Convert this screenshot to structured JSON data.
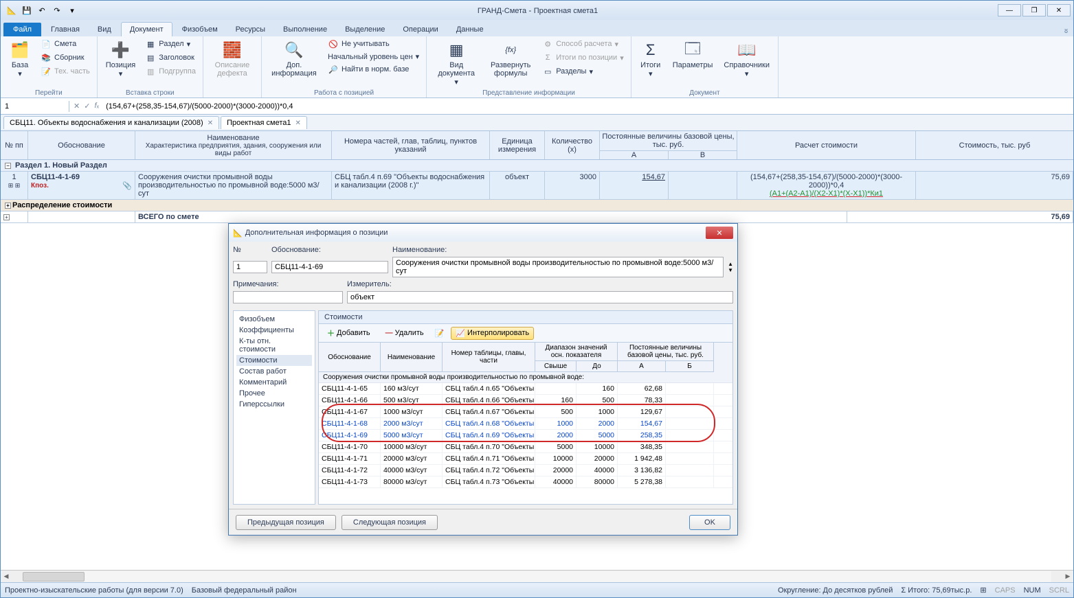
{
  "titlebar": {
    "app": "ГРАНД-Смета",
    "file": "Проектная смета1"
  },
  "tabs": {
    "file": "Файл",
    "home": "Главная",
    "view": "Вид",
    "document": "Документ",
    "fizob": "Физобъем",
    "resources": "Ресурсы",
    "exec": "Выполнение",
    "select": "Выделение",
    "ops": "Операции",
    "data": "Данные"
  },
  "ribbon": {
    "go": {
      "base": "База",
      "smeta": "Смета",
      "sbornik": "Сборник",
      "tehchast": "Тех. часть",
      "label": "Перейти"
    },
    "insert": {
      "position": "Позиция",
      "razdel": "Раздел",
      "zagolovok": "Заголовок",
      "podgruppa": "Подгруппа",
      "label": "Вставка строки"
    },
    "defect": {
      "label": "Описание дефекта"
    },
    "dopinfo": {
      "btn": "Доп. информация",
      "neuchit": "Не учитывать",
      "nachlvl": "Начальный уровень цен",
      "normbase": "Найти в норм. базе",
      "label": "Работа с позицией"
    },
    "pred": {
      "viddoc": "Вид документа",
      "razvform": "Развернуть формулы",
      "sposob": "Способ расчета",
      "itogipos": "Итоги по позиции",
      "razdely": "Разделы",
      "label": "Представление информации"
    },
    "doc": {
      "itogi": "Итоги",
      "param": "Параметры",
      "sprav": "Справочники",
      "label": "Документ"
    }
  },
  "formula": {
    "name": "1",
    "text": "(154,67+(258,35-154,67)/(5000-2000)*(3000-2000))*0,4"
  },
  "doctabs": {
    "t1": "СБЦ11. Объекты водоснабжения и канализации (2008)",
    "t2": "Проектная смета1"
  },
  "gridhead": {
    "npp": "№ пп",
    "obosn": "Обоснование",
    "naimen_top": "Наименование",
    "naimen_sub": "Характеристика предприятия, здания, сооружения или виды работ",
    "nomera": "Номера частей, глав, таблиц, пунктов указаний",
    "edin": "Единица измерения",
    "qty_top": "Количество",
    "qty_sub": "(x)",
    "const_top": "Постоянные величины базовой цены, тыс. руб.",
    "const_a": "А",
    "const_b": "В",
    "raschet": "Расчет стоимости",
    "stoim": "Стоимость, тыс. руб"
  },
  "section1": "Раздел 1. Новый Раздел",
  "row1": {
    "npp": "1",
    "obosn": "СБЦ11-4-1-69",
    "kpoz": "Кпоз.",
    "naimen": "Сооружения очистки промывной воды производительностью по промывной воде:5000 м3/сут",
    "nomera": "СБЦ табл.4 п.69 \"Объекты водоснабжения и канализации (2008 г.)\"",
    "edin": "объект",
    "qty": "3000",
    "a": "154,67",
    "raschet1": "(154,67+(258,35-154,67)/(5000-2000)*(3000-2000))*0,4",
    "raschet2": "(А1+(А2-А1)/(Х2-Х1)*(Х-Х1))*Ки1",
    "sum": "75,69"
  },
  "distrib": "Распределение стоимости",
  "total": {
    "label": "ВСЕГО по смете",
    "sum": "75,69"
  },
  "status": {
    "left1": "Проектно-изыскательские работы (для версии 7.0)",
    "left2": "Базовый федеральный район",
    "okr": "Округление: До десятков рублей",
    "itogo": "Итого: 75,69тыс.р.",
    "caps": "CAPS",
    "num": "NUM",
    "scrl": "SCRL"
  },
  "modal": {
    "title": "Дополнительная информация о позиции",
    "labels": {
      "num": "№",
      "obosn": "Обоснование:",
      "naimen": "Наименование:",
      "prim": "Примечания:",
      "izm": "Измеритель:"
    },
    "vals": {
      "num": "1",
      "obosn": "СБЦ11-4-1-69",
      "naimen": "Сооружения очистки промывной воды производительностью по промывной воде:5000 м3/сут",
      "izm": "объект"
    },
    "tree": {
      "fiz": "Физобъем",
      "koef": "Коэффициенты",
      "kty": "К-ты отн. стоимости",
      "stoim": "Стоимости",
      "sostav": "Состав работ",
      "komm": "Комментарий",
      "prochee": "Прочее",
      "hyper": "Гиперссылки"
    },
    "subtitle": "Стоимости",
    "toolbar": {
      "add": "Добавить",
      "del": "Удалить",
      "interp": "Интерполировать"
    },
    "sghead": {
      "obosn": "Обоснование",
      "naimen": "Наименование",
      "nomtab": "Номер таблицы, главы, части",
      "diap": "Диапазон значений осн. показателя",
      "pconst": "Постоянные величины базовой цены, тыс. руб.",
      "svyshe": "Свыше",
      "do": "До",
      "a": "А",
      "b": "Б"
    },
    "sggroup": "Сооружения очистки промывной воды производительностью по промывной воде:",
    "rows": [
      {
        "o": "СБЦ11-4-1-65",
        "n": "160 м3/сут",
        "t": "СБЦ табл.4 п.65 \"Объекты",
        "s": "",
        "do": "160",
        "a": "62,68",
        "hl": false
      },
      {
        "o": "СБЦ11-4-1-66",
        "n": "500 м3/сут",
        "t": "СБЦ табл.4 п.66 \"Объекты",
        "s": "160",
        "do": "500",
        "a": "78,33",
        "hl": false
      },
      {
        "o": "СБЦ11-4-1-67",
        "n": "1000 м3/сут",
        "t": "СБЦ табл.4 п.67 \"Объекты",
        "s": "500",
        "do": "1000",
        "a": "129,67",
        "hl": false
      },
      {
        "o": "СБЦ11-4-1-68",
        "n": "2000 м3/сут",
        "t": "СБЦ табл.4 п.68 \"Объекты",
        "s": "1000",
        "do": "2000",
        "a": "154,67",
        "hl": true
      },
      {
        "o": "СБЦ11-4-1-69",
        "n": "5000 м3/сут",
        "t": "СБЦ табл.4 п.69 \"Объекты",
        "s": "2000",
        "do": "5000",
        "a": "258,35",
        "hl": true
      },
      {
        "o": "СБЦ11-4-1-70",
        "n": "10000 м3/сут",
        "t": "СБЦ табл.4 п.70 \"Объекты",
        "s": "5000",
        "do": "10000",
        "a": "348,35",
        "hl": false
      },
      {
        "o": "СБЦ11-4-1-71",
        "n": "20000 м3/сут",
        "t": "СБЦ табл.4 п.71 \"Объекты",
        "s": "10000",
        "do": "20000",
        "a": "1 942,48",
        "hl": false
      },
      {
        "o": "СБЦ11-4-1-72",
        "n": "40000 м3/сут",
        "t": "СБЦ табл.4 п.72 \"Объекты",
        "s": "20000",
        "do": "40000",
        "a": "3 136,82",
        "hl": false
      },
      {
        "o": "СБЦ11-4-1-73",
        "n": "80000 м3/сут",
        "t": "СБЦ табл.4 п.73 \"Объекты",
        "s": "40000",
        "do": "80000",
        "a": "5 278,38",
        "hl": false
      }
    ],
    "footer": {
      "prev": "Предыдущая позиция",
      "next": "Следующая позиция",
      "ok": "OK"
    }
  }
}
